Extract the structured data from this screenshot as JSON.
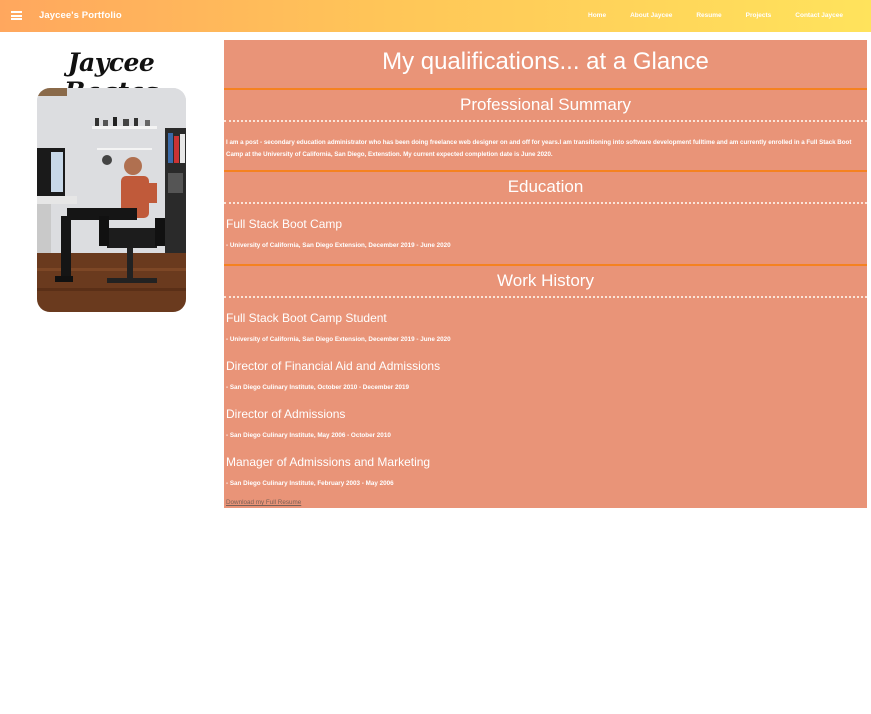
{
  "nav": {
    "brand": "Jaycee's Portfolio",
    "menu_icon": "hamburger-menu-icon",
    "links": [
      "Home",
      "About Jaycee",
      "Resume",
      "Projects",
      "Contact Jaycee"
    ]
  },
  "sidebar": {
    "name": "Jaycee Bagtas",
    "photo": "profile-photo"
  },
  "main": {
    "title": "My qualifications... at a Glance",
    "summary_heading": "Professional Summary",
    "summary_text": "I am a post - secondary education administrator who has been doing freelance web designer on and off for years.I am transitioning into software development fulltime and am currently enrolled in a Full Stack Boot Camp at the University of California, San Diego, Extenstion. My current expected completion date is June 2020.",
    "education_heading": "Education",
    "education": [
      {
        "title": "Full Stack Boot Camp",
        "detail": "- University of California, San Diego Extension, December 2019 - June 2020"
      }
    ],
    "work_heading": "Work History",
    "work": [
      {
        "title": "Full Stack Boot Camp Student",
        "detail": "- University of California, San Diego Extension, December 2019 - June 2020"
      },
      {
        "title": "Director of Financial Aid and Admissions",
        "detail": "- San Diego Culinary Institute, October 2010 - December 2019"
      },
      {
        "title": "Director of Admissions",
        "detail": "- San Diego Culinary Institute, May 2006 - October 2010"
      },
      {
        "title": "Manager of Admissions and Marketing",
        "detail": "- San Diego Culinary Institute, February 2003 - May 2006"
      }
    ],
    "download_link": "Download my Full Resume"
  },
  "colors": {
    "nav_gradient_start": "#ffa75e",
    "nav_gradient_end": "#ffe35c",
    "panel_bg": "#e99478",
    "section_rule": "#f58220"
  }
}
